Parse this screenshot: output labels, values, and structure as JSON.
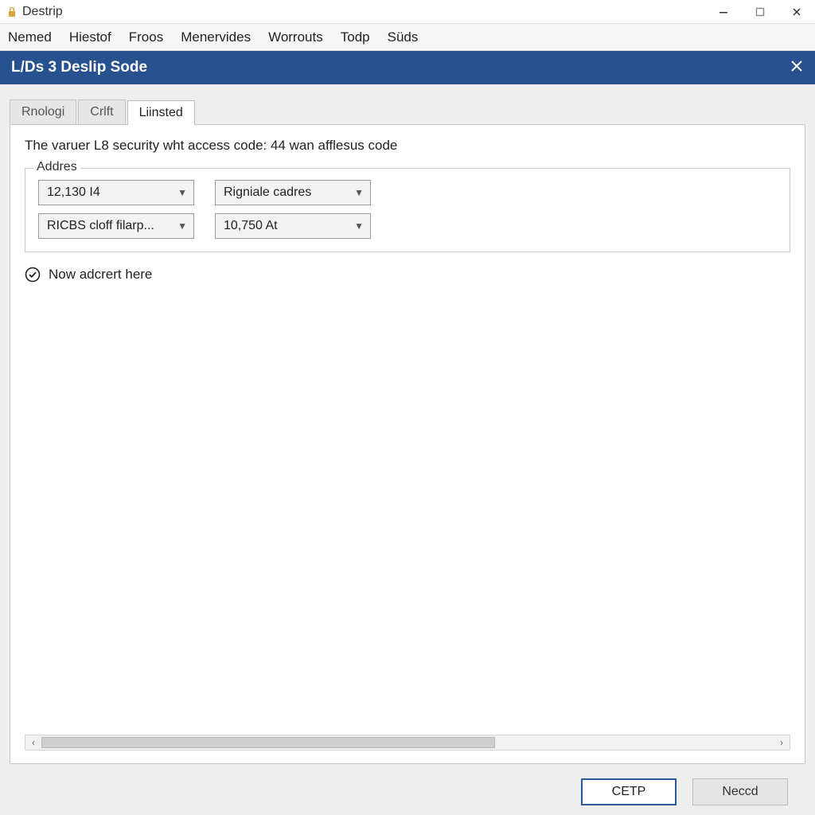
{
  "window": {
    "title": "Destrip"
  },
  "menubar": {
    "items": [
      "Nemed",
      "Hiestof",
      "Froos",
      "Menervides",
      "Worrouts",
      "Todp",
      "Süds"
    ]
  },
  "dialog": {
    "title": "L/Ds 3 Deslip Sode"
  },
  "tabs": [
    {
      "label": "Rnologi",
      "active": false
    },
    {
      "label": "Crlft",
      "active": false
    },
    {
      "label": "Liinsted",
      "active": true
    }
  ],
  "panel": {
    "description": "The varuer L8 security wht access code: 44 wan afflesus code",
    "fieldset_legend": "Addres",
    "combos": {
      "c1": "12,130 I4",
      "c2": "Rigniale cadres",
      "c3": "RICBS cloff filarp...",
      "c4": "10,750 At"
    },
    "check_label": "Now adcrert here"
  },
  "footer": {
    "primary": "CETP",
    "secondary": "Neccd"
  }
}
